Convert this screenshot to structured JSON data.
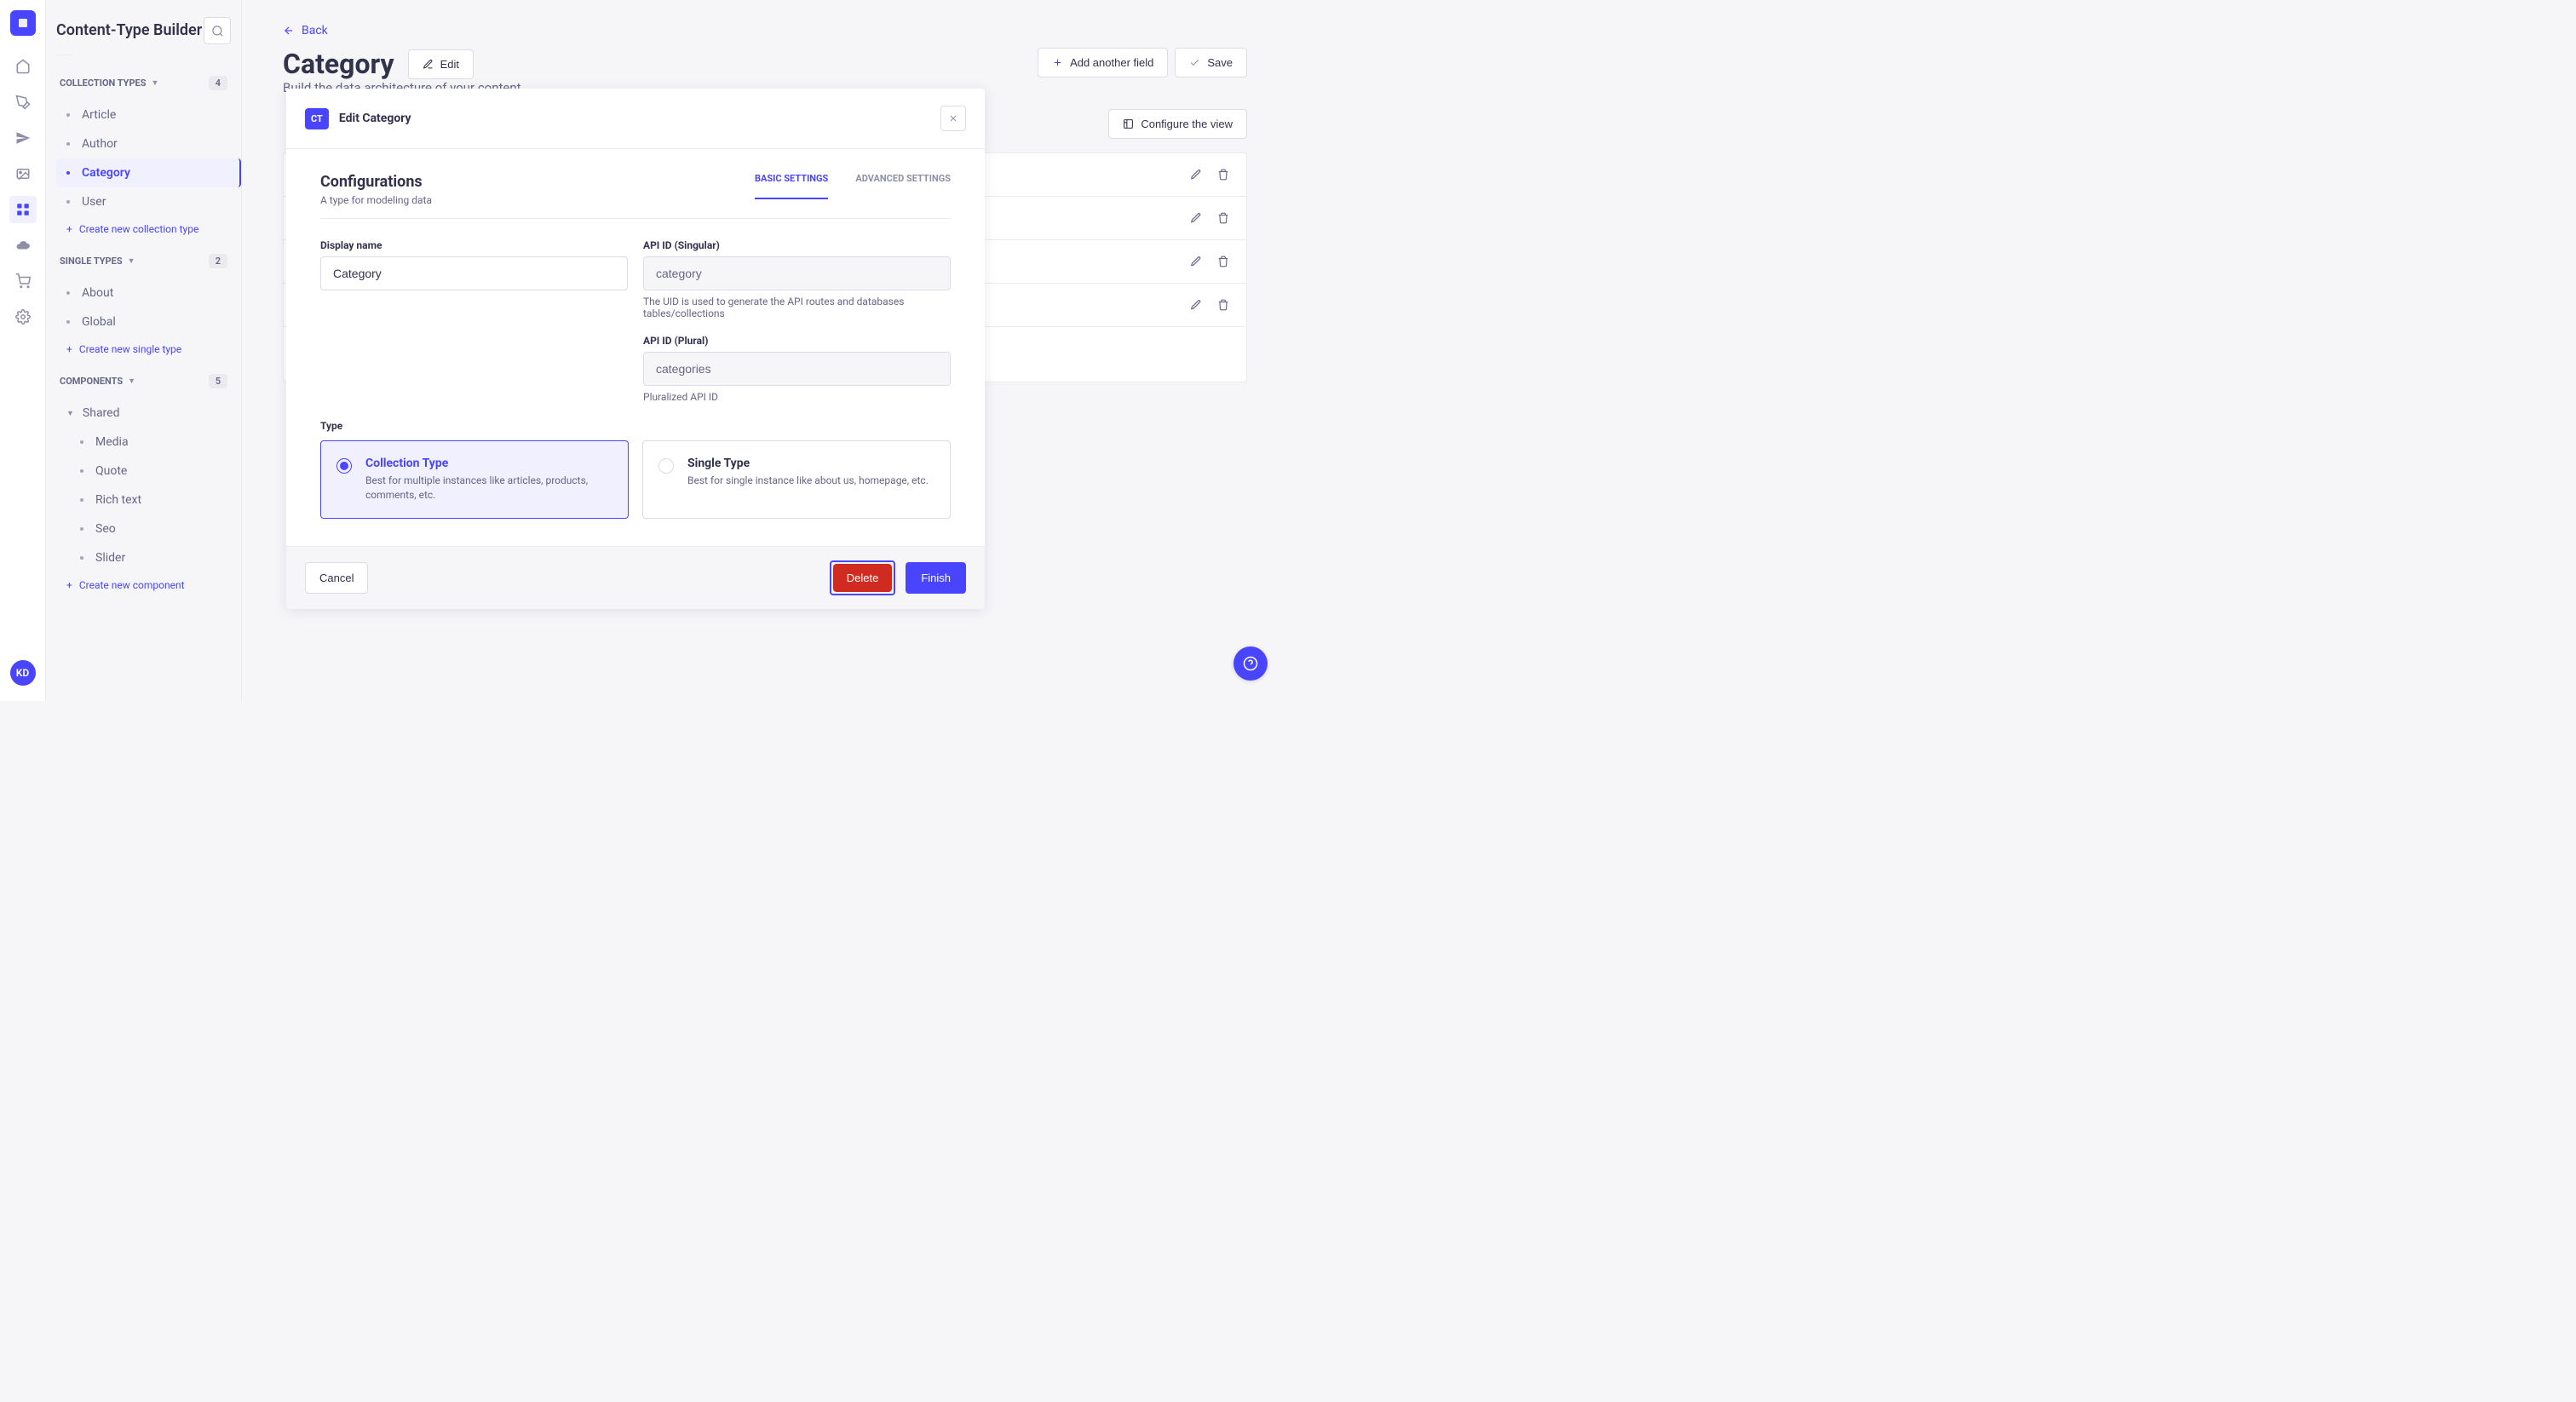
{
  "app": {
    "builder_title": "Content-Type Builder",
    "user_initials": "KD"
  },
  "sidebar": {
    "collection_types": {
      "label": "Collection Types",
      "count": "4",
      "items": [
        {
          "label": "Article"
        },
        {
          "label": "Author"
        },
        {
          "label": "Category"
        },
        {
          "label": "User"
        }
      ],
      "create": "Create new collection type"
    },
    "single_types": {
      "label": "Single Types",
      "count": "2",
      "items": [
        {
          "label": "About"
        },
        {
          "label": "Global"
        }
      ],
      "create": "Create new single type"
    },
    "components": {
      "label": "Components",
      "count": "5",
      "groups": [
        {
          "name": "Shared",
          "items": [
            {
              "label": "Media"
            },
            {
              "label": "Quote"
            },
            {
              "label": "Rich text"
            },
            {
              "label": "Seo"
            },
            {
              "label": "Slider"
            }
          ]
        }
      ],
      "create": "Create new component"
    }
  },
  "page": {
    "back": "Back",
    "title": "Category",
    "edit": "Edit",
    "add_field": "Add another field",
    "save": "Save",
    "subtitle": "Build the data architecture of your content",
    "configure": "Configure the view"
  },
  "modal": {
    "badge": "CT",
    "title": "Edit Category",
    "config_title": "Configurations",
    "config_sub": "A type for modeling data",
    "tab_basic": "Basic Settings",
    "tab_advanced": "Advanced Settings",
    "display_name_label": "Display name",
    "display_name_value": "Category",
    "api_singular_label": "API ID (Singular)",
    "api_singular_value": "category",
    "api_singular_help": "The UID is used to generate the API routes and databases tables/collections",
    "api_plural_label": "API ID (Plural)",
    "api_plural_value": "categories",
    "api_plural_help": "Pluralized API ID",
    "type_label": "Type",
    "type_collection_title": "Collection Type",
    "type_collection_desc": "Best for multiple instances like articles, products, comments, etc.",
    "type_single_title": "Single Type",
    "type_single_desc": "Best for single instance like about us, homepage, etc.",
    "cancel": "Cancel",
    "delete": "Delete",
    "finish": "Finish"
  }
}
